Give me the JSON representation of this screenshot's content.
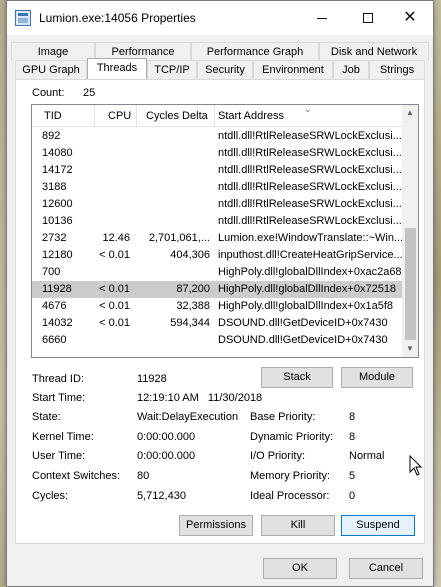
{
  "window": {
    "title": "Lumion.exe:14056 Properties"
  },
  "tabs_row1": [
    "Image",
    "Performance",
    "Performance Graph",
    "Disk and Network"
  ],
  "tabs_row2": [
    "GPU Graph",
    "Threads",
    "TCP/IP",
    "Security",
    "Environment",
    "Job",
    "Strings"
  ],
  "active_tab": "Threads",
  "count": {
    "label": "Count:",
    "value": "25"
  },
  "columns": [
    "TID",
    "CPU",
    "Cycles Delta",
    "Start Address"
  ],
  "threads": [
    {
      "tid": "892",
      "cpu": "",
      "delta": "",
      "addr": "ntdll.dll!RtlReleaseSRWLockExclusi..."
    },
    {
      "tid": "14080",
      "cpu": "",
      "delta": "",
      "addr": "ntdll.dll!RtlReleaseSRWLockExclusi..."
    },
    {
      "tid": "14172",
      "cpu": "",
      "delta": "",
      "addr": "ntdll.dll!RtlReleaseSRWLockExclusi..."
    },
    {
      "tid": "3188",
      "cpu": "",
      "delta": "",
      "addr": "ntdll.dll!RtlReleaseSRWLockExclusi..."
    },
    {
      "tid": "12600",
      "cpu": "",
      "delta": "",
      "addr": "ntdll.dll!RtlReleaseSRWLockExclusi..."
    },
    {
      "tid": "10136",
      "cpu": "",
      "delta": "",
      "addr": "ntdll.dll!RtlReleaseSRWLockExclusi..."
    },
    {
      "tid": "2732",
      "cpu": "12.46",
      "delta": "2,701,061,...",
      "addr": "Lumion.exe!WindowTranslate::~Win..."
    },
    {
      "tid": "12180",
      "cpu": "< 0.01",
      "delta": "404,306",
      "addr": "inputhost.dll!CreateHeatGripService..."
    },
    {
      "tid": "700",
      "cpu": "",
      "delta": "",
      "addr": "HighPoly.dll!globalDllIndex+0xac2a68"
    },
    {
      "tid": "11928",
      "cpu": "< 0.01",
      "delta": "87,200",
      "addr": "HighPoly.dll!globalDllIndex+0x72518",
      "selected": true
    },
    {
      "tid": "4676",
      "cpu": "< 0.01",
      "delta": "32,388",
      "addr": "HighPoly.dll!globalDllIndex+0x1a5f8"
    },
    {
      "tid": "14032",
      "cpu": "< 0.01",
      "delta": "594,344",
      "addr": "DSOUND.dll!GetDeviceID+0x7430"
    },
    {
      "tid": "6660",
      "cpu": "",
      "delta": "",
      "addr": "DSOUND.dll!GetDeviceID+0x7430"
    }
  ],
  "details": {
    "thread_id_label": "Thread ID:",
    "thread_id": "11928",
    "start_time_label": "Start Time:",
    "start_time": "12:19:10 AM   11/30/2018",
    "state_label": "State:",
    "state": "Wait:DelayExecution",
    "kernel_time_label": "Kernel Time:",
    "kernel_time": "0:00:00.000",
    "user_time_label": "User Time:",
    "user_time": "0:00:00.000",
    "context_switches_label": "Context Switches:",
    "context_switches": "80",
    "cycles_label": "Cycles:",
    "cycles": "5,712,430",
    "base_priority_label": "Base Priority:",
    "base_priority": "8",
    "dynamic_priority_label": "Dynamic Priority:",
    "dynamic_priority": "8",
    "io_priority_label": "I/O Priority:",
    "io_priority": "Normal",
    "memory_priority_label": "Memory Priority:",
    "memory_priority": "5",
    "ideal_processor_label": "Ideal Processor:",
    "ideal_processor": "0"
  },
  "buttons": {
    "stack": "Stack",
    "module": "Module",
    "permissions": "Permissions",
    "kill": "Kill",
    "suspend": "Suspend",
    "ok": "OK",
    "cancel": "Cancel"
  }
}
